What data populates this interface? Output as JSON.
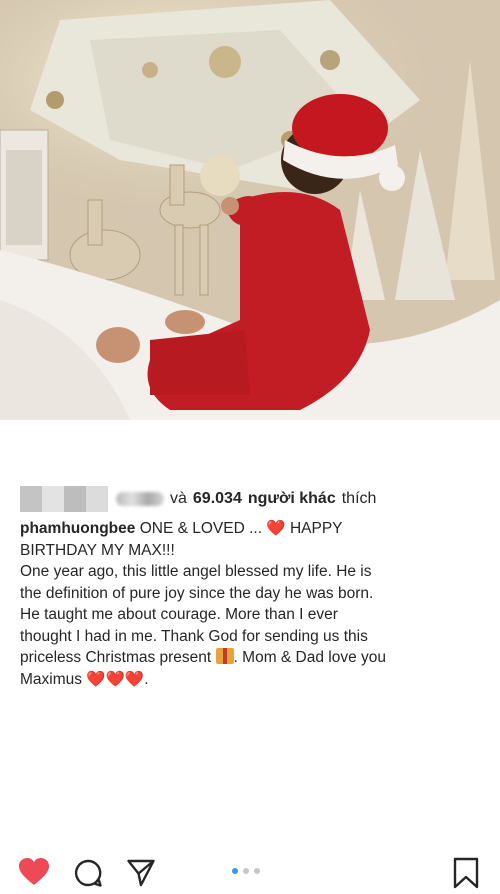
{
  "post": {
    "image_alt_icon": "christmas-photo",
    "carousel": {
      "count": 3,
      "active_index": 0
    },
    "liked": true
  },
  "likes": {
    "connector": "và",
    "count": "69.034",
    "others_label": "người khác",
    "suffix": "thích"
  },
  "caption": {
    "username": "phamhuongbee",
    "line1_a": "ONE & LOVED ...",
    "heart": "❤️",
    "line1_b": "HAPPY",
    "line2": "BIRTHDAY MY MAX!!!",
    "body1": "One year ago, this little angel blessed my life. He is",
    "body2": "the definition of pure joy since the day he was born.",
    "body3": "He taught me about courage. More than I ever",
    "body4": "thought I had in me. Thank God for sending us this",
    "body5a": "priceless Christmas present",
    "body5b": ". Mom & Dad love you",
    "body6": "Maximus",
    "hearts_end": "❤️❤️❤️",
    "period": "."
  },
  "colors": {
    "like_red": "#ed4956",
    "dot_active": "#3897f0",
    "dot_inactive": "#c7c7c7"
  }
}
